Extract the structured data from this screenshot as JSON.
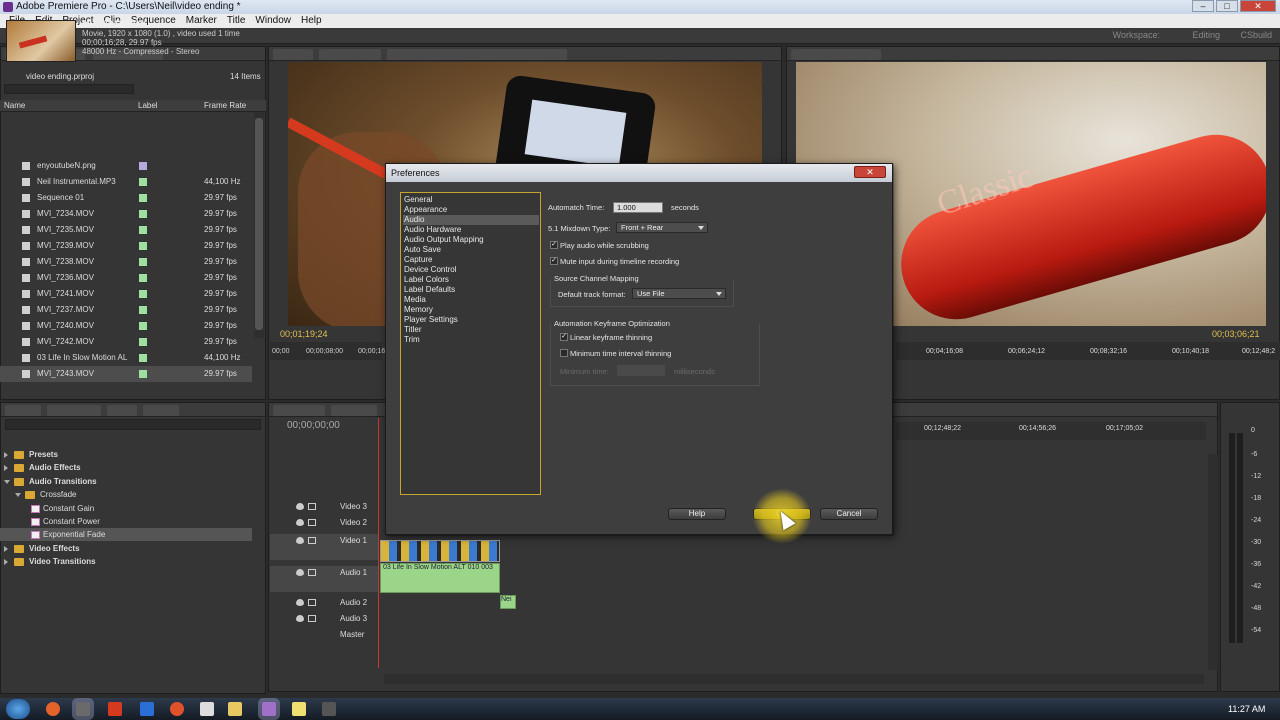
{
  "window": {
    "title": "Adobe Premiere Pro - C:\\Users\\Neil\\video ending *",
    "minimize": "–",
    "maximize": "□",
    "close": "✕"
  },
  "menu": [
    "File",
    "Edit",
    "Project",
    "Clip",
    "Sequence",
    "Marker",
    "Title",
    "Window",
    "Help"
  ],
  "toolbar": {
    "workspace_label": "Workspace:",
    "workspace_value": "Editing",
    "search": "CSbuild"
  },
  "project": {
    "clip_name": "MVI_7243.MOV",
    "clip_info_1": "Movie, 1920 x 1080 (1.0)  ,  video used 1 time",
    "clip_info_2": "00;00;16;28, 29.97 fps",
    "clip_info_3": "48000 Hz - Compressed - Stereo",
    "project_name": "video ending.prproj",
    "item_count": "14 Items",
    "columns": {
      "name": "Name",
      "label": "Label",
      "frame_rate": "Frame Rate"
    },
    "items": [
      {
        "name": "enyoutubeN.png",
        "rate": "",
        "color": "#b8a8e0"
      },
      {
        "name": "Neil Instrumental.MP3",
        "rate": "44,100 Hz",
        "color": "#9ee0a0"
      },
      {
        "name": "Sequence 01",
        "rate": "29.97 fps",
        "color": "#9ee0a0"
      },
      {
        "name": "MVI_7234.MOV",
        "rate": "29.97 fps",
        "color": "#9ee0a0"
      },
      {
        "name": "MVI_7235.MOV",
        "rate": "29.97 fps",
        "color": "#9ee0a0"
      },
      {
        "name": "MVI_7239.MOV",
        "rate": "29.97 fps",
        "color": "#9ee0a0"
      },
      {
        "name": "MVI_7238.MOV",
        "rate": "29.97 fps",
        "color": "#9ee0a0"
      },
      {
        "name": "MVI_7236.MOV",
        "rate": "29.97 fps",
        "color": "#9ee0a0"
      },
      {
        "name": "MVI_7241.MOV",
        "rate": "29.97 fps",
        "color": "#9ee0a0"
      },
      {
        "name": "MVI_7237.MOV",
        "rate": "29.97 fps",
        "color": "#9ee0a0"
      },
      {
        "name": "MVI_7240.MOV",
        "rate": "29.97 fps",
        "color": "#9ee0a0"
      },
      {
        "name": "MVI_7242.MOV",
        "rate": "29.97 fps",
        "color": "#9ee0a0"
      },
      {
        "name": "03 Life In Slow Motion AL",
        "rate": "44,100 Hz",
        "color": "#9ee0a0"
      },
      {
        "name": "MVI_7243.MOV",
        "rate": "29.97 fps",
        "color": "#9ee0a0"
      }
    ]
  },
  "effects": {
    "items": [
      {
        "label": "Presets",
        "level": 0,
        "open": false
      },
      {
        "label": "Audio Effects",
        "level": 0,
        "open": false
      },
      {
        "label": "Audio Transitions",
        "level": 0,
        "open": true
      },
      {
        "label": "Crossfade",
        "level": 1,
        "open": true
      },
      {
        "label": "Constant Gain",
        "level": 2
      },
      {
        "label": "Constant Power",
        "level": 2
      },
      {
        "label": "Exponential Fade",
        "level": 2
      },
      {
        "label": "Video Effects",
        "level": 0,
        "open": false
      },
      {
        "label": "Video Transitions",
        "level": 0,
        "open": false
      }
    ]
  },
  "source": {
    "timecode": "00;01;19;24",
    "ruler": [
      "00;00",
      "00;00;08;00",
      "00;00;16"
    ]
  },
  "program": {
    "timecode": "00;03;06;21",
    "ruler": [
      "00;04;16;08",
      "00;06;24;12",
      "00;08;32;16",
      "00;10;40;18",
      "00;12;48;2"
    ],
    "overlay_text": "Classic"
  },
  "timeline": {
    "timecode": "00;00;00;00",
    "ruler": [
      "00;12;48;22",
      "00;14;56;26",
      "00;17;05;02"
    ],
    "tracks": [
      "Video 3",
      "Video 2",
      "Video 1",
      "Audio 1",
      "Audio 2",
      "Audio 3",
      "Master"
    ],
    "audio_clip": "03 Life In Slow Motion ALT 010 003",
    "audio_clip_2": "Nei"
  },
  "meters": {
    "top": "0",
    "ticks": [
      "-6",
      "-12",
      "-18",
      "-24",
      "-30",
      "-36",
      "-42",
      "-48",
      "-54"
    ]
  },
  "taskbar": {
    "time": "11:27 AM"
  },
  "dialog": {
    "title": "Preferences",
    "close": "✕",
    "categories": [
      "General",
      "Appearance",
      "Audio",
      "Audio Hardware",
      "Audio Output Mapping",
      "Auto Save",
      "Capture",
      "Device Control",
      "Label Colors",
      "Label Defaults",
      "Media",
      "Memory",
      "Player Settings",
      "Titler",
      "Trim"
    ],
    "selected_index": 2,
    "automatch_label": "Automatch Time:",
    "automatch_value": "1.000",
    "automatch_unit": "seconds",
    "mixdown_label": "5.1 Mixdown Type:",
    "mixdown_value": "Front + Rear",
    "play_audio_label": "Play audio while scrubbing",
    "play_audio_checked": true,
    "mute_input_label": "Mute input during timeline recording",
    "mute_input_checked": true,
    "source_channel_group": "Source Channel Mapping",
    "default_track_label": "Default track format:",
    "default_track_value": "Use File",
    "keyframe_group": "Automation Keyframe Optimization",
    "linear_label": "Linear keyframe thinning",
    "linear_checked": true,
    "min_interval_label": "Minimum time interval thinning",
    "min_interval_checked": false,
    "min_time_label": "Minimum time:",
    "min_time_unit": "milliseconds",
    "help_button": "Help",
    "ok_button": "OK",
    "cancel_button": "Cancel"
  }
}
